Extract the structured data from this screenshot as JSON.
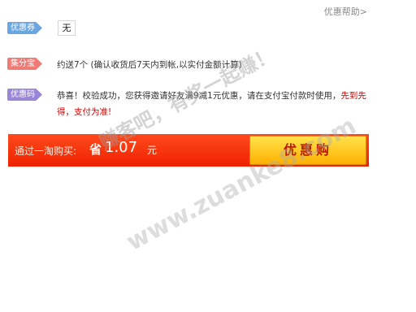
{
  "help_link": "优惠帮助>",
  "coupon": {
    "tag": "优惠券",
    "value": "无"
  },
  "points": {
    "tag": "集分宝",
    "text": "约送7个 (确认收货后7天内到帐,以实付金额计算)"
  },
  "code": {
    "tag": "优惠码",
    "msg_part1": "恭喜！校验成功，您获得邀请好友满9减1元优惠，请在支付宝付款时使用，",
    "msg_red1": "先到先得",
    "msg_sep": "，",
    "msg_red2": "支付为准!"
  },
  "buy_bar": {
    "prefix": "通过一淘购买:",
    "save_label": "省",
    "amount": "1.07",
    "unit": "元",
    "button_label": "优惠购"
  },
  "watermark": {
    "text": "赚客吧，有奖一起赚！",
    "url": "www.zuanke8.com"
  },
  "colors": {
    "accent": "#ee2200",
    "button": "#ffb000"
  }
}
